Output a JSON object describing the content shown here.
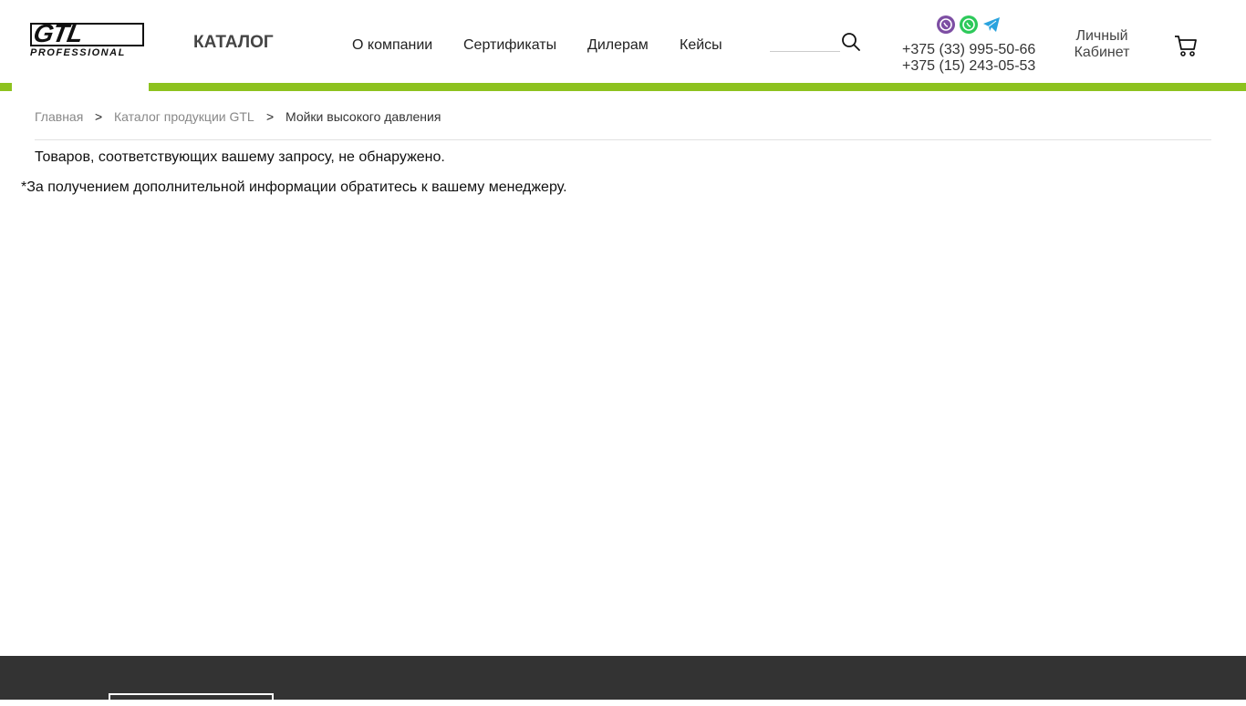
{
  "header": {
    "logo_text": "GTL",
    "logo_sub": "PROFESSIONAL",
    "catalog_label": "КАТАЛОГ",
    "nav": [
      "О компании",
      "Сертификаты",
      "Дилерам",
      "Кейсы"
    ],
    "search": {
      "placeholder": "",
      "value": ""
    },
    "messengers": [
      "viber-icon",
      "whatsapp-icon",
      "telegram-icon"
    ],
    "phones": [
      "+375 (33) 995-50-66",
      "+375 (15) 243-05-53"
    ],
    "cabinet_label": "Личный Кабинет"
  },
  "breadcrumb": {
    "items": [
      "Главная",
      "Каталог продукции GTL",
      "Мойки высокого давления"
    ],
    "separator": ">"
  },
  "main": {
    "no_results": "Товаров, соответствующих вашему запросу, не обнаружено.",
    "note": "*За получением дополнительной информации обратитесь к вашему менеджеру."
  },
  "colors": {
    "accent_green": "#8dc21f",
    "footer_bg": "#333333",
    "viber": "#7d4ea3",
    "whatsapp": "#2dc95a",
    "telegram": "#2aa3de"
  }
}
